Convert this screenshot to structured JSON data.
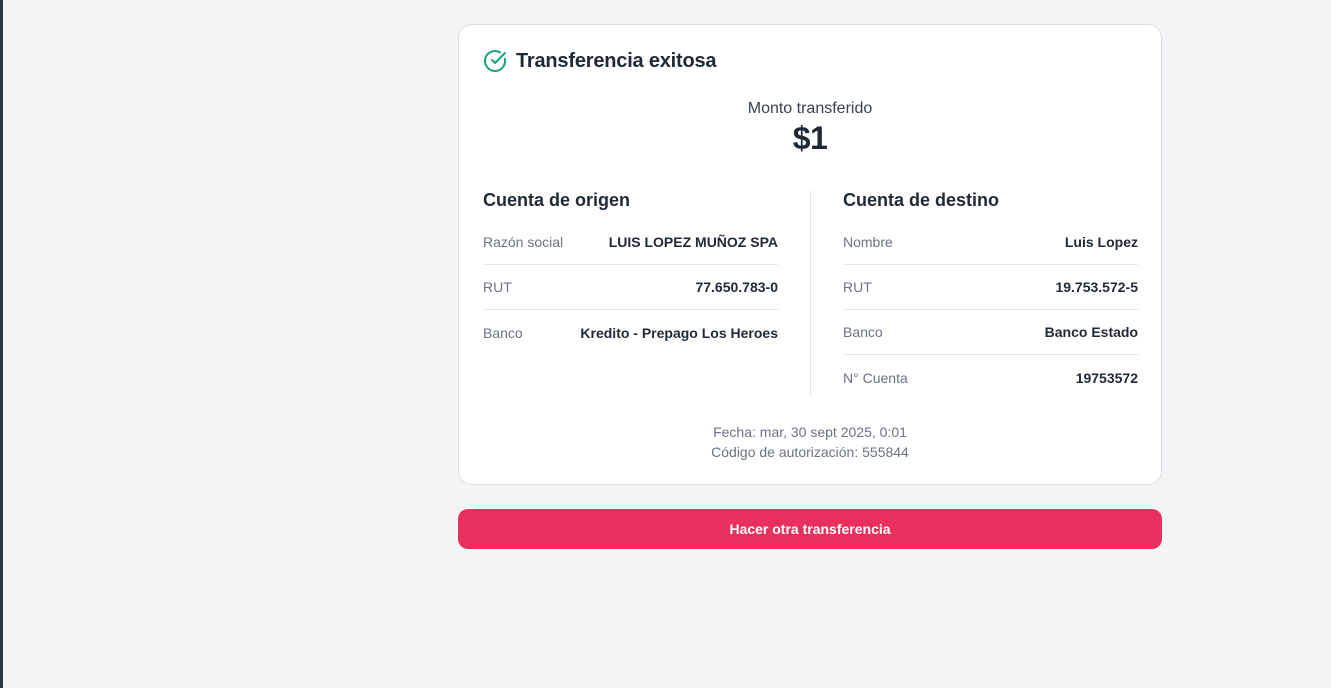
{
  "header": {
    "title": "Transferencia exitosa",
    "icon": "check-circle-icon"
  },
  "amount": {
    "label": "Monto transferido",
    "value": "$1"
  },
  "origin": {
    "title": "Cuenta de origen",
    "rows": [
      {
        "label": "Razón social",
        "value": "LUIS LOPEZ MUÑOZ SPA"
      },
      {
        "label": "RUT",
        "value": "77.650.783-0"
      },
      {
        "label": "Banco",
        "value": "Kredito - Prepago Los Heroes"
      }
    ]
  },
  "destination": {
    "title": "Cuenta de destino",
    "rows": [
      {
        "label": "Nombre",
        "value": "Luis Lopez"
      },
      {
        "label": "RUT",
        "value": "19.753.572-5"
      },
      {
        "label": "Banco",
        "value": "Banco Estado"
      },
      {
        "label": "N° Cuenta",
        "value": "19753572"
      }
    ]
  },
  "footer": {
    "date": "Fecha: mar, 30 sept 2025, 0:01",
    "auth_code": "Código de autorización: 555844"
  },
  "actions": {
    "new_transfer_label": "Hacer otra transferencia"
  },
  "colors": {
    "accent": "#e8305e",
    "success": "#16a37a"
  }
}
